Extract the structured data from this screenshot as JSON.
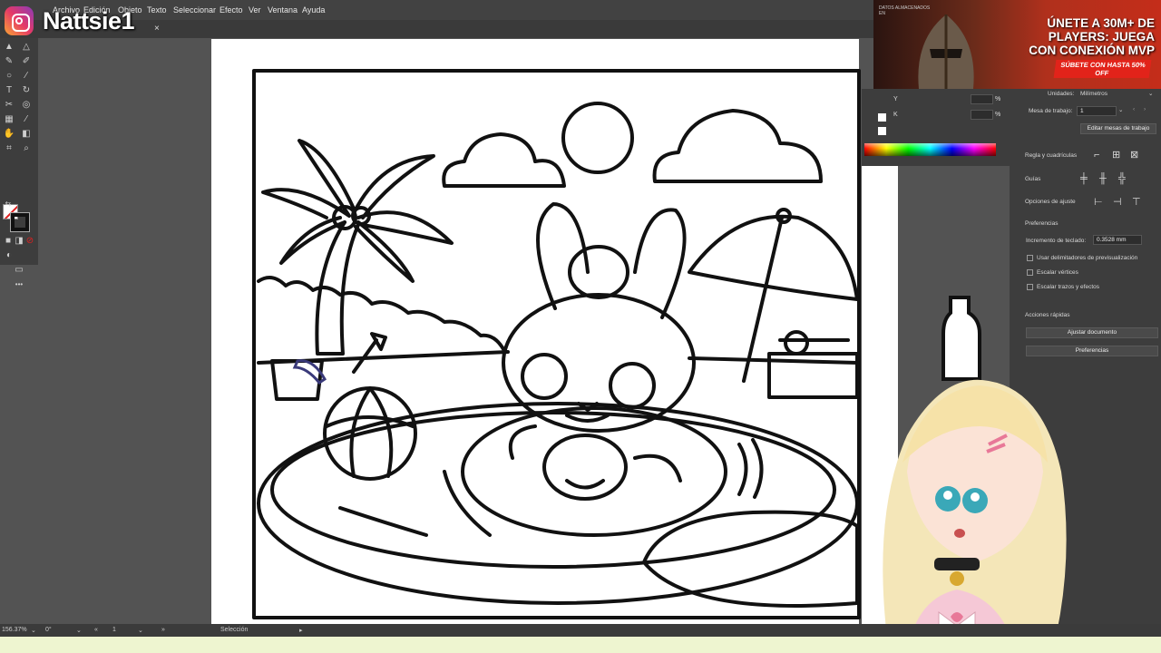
{
  "stream": {
    "brand_name": "Nattsie1"
  },
  "menu": {
    "items": [
      "Archivo",
      "Edición",
      "Objeto",
      "Texto",
      "Seleccionar",
      "Efecto",
      "Ver",
      "Ventana",
      "Ayuda"
    ]
  },
  "tab": {
    "close": "×"
  },
  "ad": {
    "small_text": "DATOS ALMACENADOS EN",
    "headline": "ÚNETE A 30M+ DE PLAYERS: JUEGA CON CONEXIÓN MVP",
    "cta": "SÚBETE CON HASTA 50% OFF"
  },
  "color_panel": {
    "y_label": "Y",
    "k_label": "K",
    "pct1": "%",
    "pct2": "%"
  },
  "properties": {
    "units_label": "Unidades:",
    "units_value": "Milímetros",
    "artboard_label": "Mesa de trabajo:",
    "artboard_value": "1",
    "edit_artboards": "Editar mesas de trabajo",
    "rulers_label": "Regla y cuadrículas",
    "guides_label": "Guías",
    "snap_label": "Opciones de ajuste",
    "prefs_label": "Preferencias",
    "keyboard_increment_label": "Incremento de teclado:",
    "keyboard_increment_value": "0.3528 mm",
    "check1": "Usar delimitadores de previsualización",
    "check2": "Escalar vértices",
    "check3": "Escalar trazos y efectos",
    "quick_actions": "Acciones rápidas",
    "fit_document": "Ajustar documento",
    "preferences_button": "Preferencias"
  },
  "status": {
    "zoom": "156.37%",
    "rotation": "0°",
    "artboard": "1",
    "tool": "Selección"
  },
  "colors": {
    "accent": "#e2231a",
    "canvas": "#535353",
    "panel": "#3d3d3d"
  }
}
